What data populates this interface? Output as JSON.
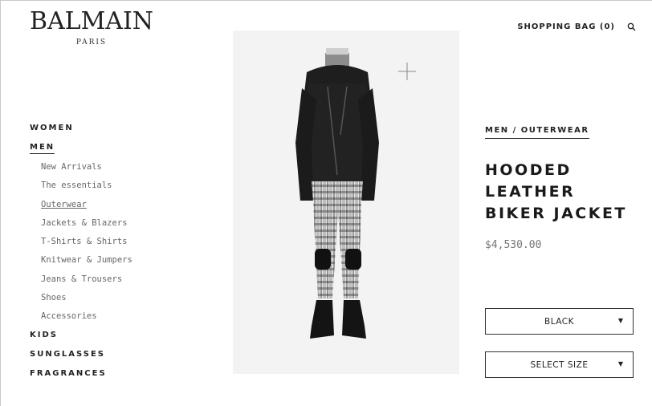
{
  "header": {
    "logo_main": "BALMAIN",
    "logo_sub": "PARIS",
    "shopping_bag": "SHOPPING BAG (0)",
    "search_icon": "search-icon"
  },
  "nav": {
    "women": "WOMEN",
    "men": "MEN",
    "men_items": [
      "New Arrivals",
      "The essentials",
      "Outerwear",
      "Jackets & Blazers",
      "T-Shirts & Shirts",
      "Knitwear & Jumpers",
      "Jeans & Trousers",
      "Shoes",
      "Accessories"
    ],
    "active_item": "Outerwear",
    "kids": "KIDS",
    "sunglasses": "SUNGLASSES",
    "fragrances": "FRAGRANCES"
  },
  "product": {
    "breadcrumb": "MEN / OUTERWEAR",
    "title": "HOODED LEATHER BIKER JACKET",
    "price": "$4,530.00",
    "color_value": "BLACK",
    "size_placeholder": "SELECT SIZE",
    "dropdown_icon": "caret-down-icon"
  },
  "colors": {
    "text": "#1a1a1a",
    "muted": "#666666",
    "photo_bg": "#f3f3f3"
  }
}
